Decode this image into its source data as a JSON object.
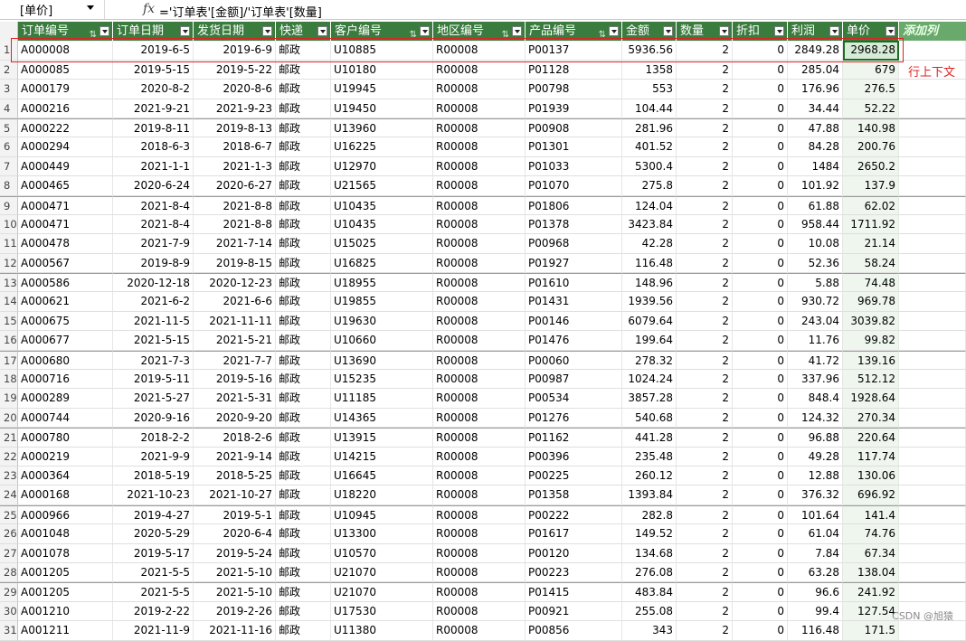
{
  "formula_bar": {
    "name_box": "[单价]",
    "fx_symbol": "fx",
    "formula": "='订单表'[金额]/'订单表'[数量]"
  },
  "table": {
    "columns": [
      {
        "label": "订单编号",
        "filter": true,
        "sort": true
      },
      {
        "label": "订单日期",
        "filter": true,
        "sort": false
      },
      {
        "label": "发货日期",
        "filter": true,
        "sort": false
      },
      {
        "label": "快递",
        "filter": true,
        "sort": false
      },
      {
        "label": "客户编号",
        "filter": true,
        "sort": true
      },
      {
        "label": "地区编号",
        "filter": true,
        "sort": true
      },
      {
        "label": "产品编号",
        "filter": true,
        "sort": true
      },
      {
        "label": "金额",
        "filter": true,
        "sort": false
      },
      {
        "label": "数量",
        "filter": true,
        "sort": false
      },
      {
        "label": "折扣",
        "filter": true,
        "sort": false
      },
      {
        "label": "利润",
        "filter": true,
        "sort": false
      },
      {
        "label": "单价",
        "filter": true,
        "sort": false
      }
    ],
    "add_column_label": "添加列",
    "rows": [
      [
        "1",
        "A000008",
        "2019-6-5",
        "2019-6-9",
        "邮政",
        "U10885",
        "R00008",
        "P00137",
        "5936.56",
        "2",
        "0",
        "2849.28",
        "2968.28"
      ],
      [
        "2",
        "A000085",
        "2019-5-15",
        "2019-5-22",
        "邮政",
        "U10180",
        "R00008",
        "P01128",
        "1358",
        "2",
        "0",
        "285.04",
        "679"
      ],
      [
        "3",
        "A000179",
        "2020-8-2",
        "2020-8-6",
        "邮政",
        "U19945",
        "R00008",
        "P00798",
        "553",
        "2",
        "0",
        "176.96",
        "276.5"
      ],
      [
        "4",
        "A000216",
        "2021-9-21",
        "2021-9-23",
        "邮政",
        "U19450",
        "R00008",
        "P01939",
        "104.44",
        "2",
        "0",
        "34.44",
        "52.22"
      ],
      [
        "5",
        "A000222",
        "2019-8-11",
        "2019-8-13",
        "邮政",
        "U13960",
        "R00008",
        "P00908",
        "281.96",
        "2",
        "0",
        "47.88",
        "140.98"
      ],
      [
        "6",
        "A000294",
        "2018-6-3",
        "2018-6-7",
        "邮政",
        "U16225",
        "R00008",
        "P01301",
        "401.52",
        "2",
        "0",
        "84.28",
        "200.76"
      ],
      [
        "7",
        "A000449",
        "2021-1-1",
        "2021-1-3",
        "邮政",
        "U12970",
        "R00008",
        "P01033",
        "5300.4",
        "2",
        "0",
        "1484",
        "2650.2"
      ],
      [
        "8",
        "A000465",
        "2020-6-24",
        "2020-6-27",
        "邮政",
        "U21565",
        "R00008",
        "P01070",
        "275.8",
        "2",
        "0",
        "101.92",
        "137.9"
      ],
      [
        "9",
        "A000471",
        "2021-8-4",
        "2021-8-8",
        "邮政",
        "U10435",
        "R00008",
        "P01806",
        "124.04",
        "2",
        "0",
        "61.88",
        "62.02"
      ],
      [
        "10",
        "A000471",
        "2021-8-4",
        "2021-8-8",
        "邮政",
        "U10435",
        "R00008",
        "P01378",
        "3423.84",
        "2",
        "0",
        "958.44",
        "1711.92"
      ],
      [
        "11",
        "A000478",
        "2021-7-9",
        "2021-7-14",
        "邮政",
        "U15025",
        "R00008",
        "P00968",
        "42.28",
        "2",
        "0",
        "10.08",
        "21.14"
      ],
      [
        "12",
        "A000567",
        "2019-8-9",
        "2019-8-15",
        "邮政",
        "U16825",
        "R00008",
        "P01927",
        "116.48",
        "2",
        "0",
        "52.36",
        "58.24"
      ],
      [
        "13",
        "A000586",
        "2020-12-18",
        "2020-12-23",
        "邮政",
        "U18955",
        "R00008",
        "P01610",
        "148.96",
        "2",
        "0",
        "5.88",
        "74.48"
      ],
      [
        "14",
        "A000621",
        "2021-6-2",
        "2021-6-6",
        "邮政",
        "U19855",
        "R00008",
        "P01431",
        "1939.56",
        "2",
        "0",
        "930.72",
        "969.78"
      ],
      [
        "15",
        "A000675",
        "2021-11-5",
        "2021-11-11",
        "邮政",
        "U19630",
        "R00008",
        "P00146",
        "6079.64",
        "2",
        "0",
        "243.04",
        "3039.82"
      ],
      [
        "16",
        "A000677",
        "2021-5-15",
        "2021-5-21",
        "邮政",
        "U10660",
        "R00008",
        "P01476",
        "199.64",
        "2",
        "0",
        "11.76",
        "99.82"
      ],
      [
        "17",
        "A000680",
        "2021-7-3",
        "2021-7-7",
        "邮政",
        "U13690",
        "R00008",
        "P00060",
        "278.32",
        "2",
        "0",
        "41.72",
        "139.16"
      ],
      [
        "18",
        "A000716",
        "2019-5-11",
        "2019-5-16",
        "邮政",
        "U15235",
        "R00008",
        "P00987",
        "1024.24",
        "2",
        "0",
        "337.96",
        "512.12"
      ],
      [
        "19",
        "A000289",
        "2021-5-27",
        "2021-5-31",
        "邮政",
        "U11185",
        "R00008",
        "P00534",
        "3857.28",
        "2",
        "0",
        "848.4",
        "1928.64"
      ],
      [
        "20",
        "A000744",
        "2020-9-16",
        "2020-9-20",
        "邮政",
        "U14365",
        "R00008",
        "P01276",
        "540.68",
        "2",
        "0",
        "124.32",
        "270.34"
      ],
      [
        "21",
        "A000780",
        "2018-2-2",
        "2018-2-6",
        "邮政",
        "U13915",
        "R00008",
        "P01162",
        "441.28",
        "2",
        "0",
        "96.88",
        "220.64"
      ],
      [
        "22",
        "A000219",
        "2021-9-9",
        "2021-9-14",
        "邮政",
        "U14215",
        "R00008",
        "P00396",
        "235.48",
        "2",
        "0",
        "49.28",
        "117.74"
      ],
      [
        "23",
        "A000364",
        "2018-5-19",
        "2018-5-25",
        "邮政",
        "U16645",
        "R00008",
        "P00225",
        "260.12",
        "2",
        "0",
        "12.88",
        "130.06"
      ],
      [
        "24",
        "A000168",
        "2021-10-23",
        "2021-10-27",
        "邮政",
        "U18220",
        "R00008",
        "P01358",
        "1393.84",
        "2",
        "0",
        "376.32",
        "696.92"
      ],
      [
        "25",
        "A000966",
        "2019-4-27",
        "2019-5-1",
        "邮政",
        "U10945",
        "R00008",
        "P00222",
        "282.8",
        "2",
        "0",
        "101.64",
        "141.4"
      ],
      [
        "26",
        "A001048",
        "2020-5-29",
        "2020-6-4",
        "邮政",
        "U13300",
        "R00008",
        "P01617",
        "149.52",
        "2",
        "0",
        "61.04",
        "74.76"
      ],
      [
        "27",
        "A001078",
        "2019-5-17",
        "2019-5-24",
        "邮政",
        "U10570",
        "R00008",
        "P00120",
        "134.68",
        "2",
        "0",
        "7.84",
        "67.34"
      ],
      [
        "28",
        "A001205",
        "2021-5-5",
        "2021-5-10",
        "邮政",
        "U21070",
        "R00008",
        "P00223",
        "276.08",
        "2",
        "0",
        "63.28",
        "138.04"
      ],
      [
        "29",
        "A001205",
        "2021-5-5",
        "2021-5-10",
        "邮政",
        "U21070",
        "R00008",
        "P01415",
        "483.84",
        "2",
        "0",
        "96.6",
        "241.92"
      ],
      [
        "30",
        "A001210",
        "2019-2-22",
        "2019-2-26",
        "邮政",
        "U17530",
        "R00008",
        "P00921",
        "255.08",
        "2",
        "0",
        "99.4",
        "127.54"
      ],
      [
        "31",
        "A001211",
        "2021-11-9",
        "2021-11-16",
        "邮政",
        "U11380",
        "R00008",
        "P00856",
        "343",
        "2",
        "0",
        "116.48",
        "171.5"
      ]
    ]
  },
  "annotation": {
    "label": "行上下文",
    "color": "#e02020"
  },
  "watermark": "CSDN @旭猿",
  "colors": {
    "header_bg": "#3a7b3e",
    "header_text": "#ffffff",
    "selected_cell_border": "#1e6b23"
  }
}
